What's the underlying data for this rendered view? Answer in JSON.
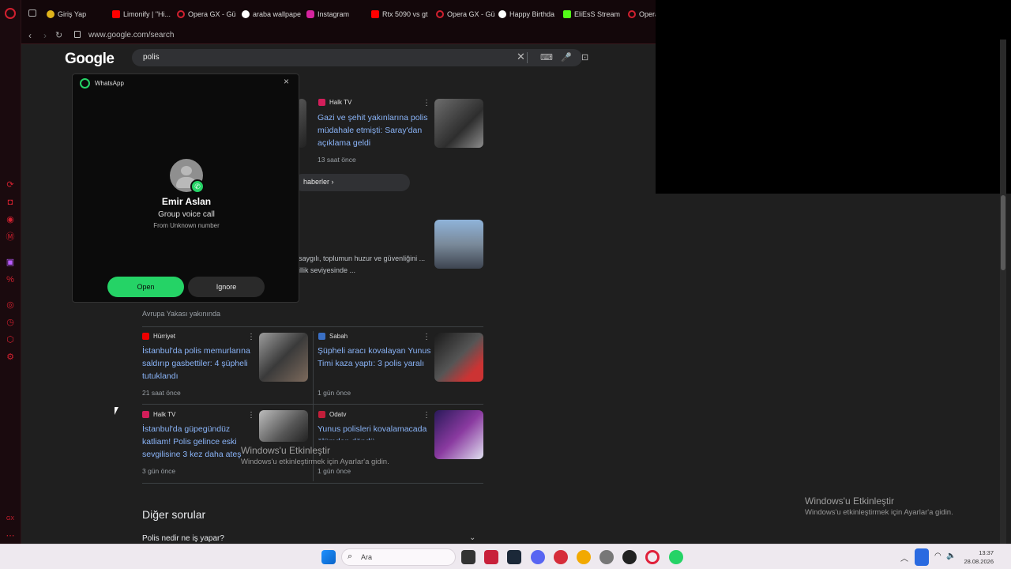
{
  "tabs": [
    "Giriş Yap",
    "Limonify | \"Hi...",
    "Opera GX - Gü",
    "araba wallpape",
    "Instagram",
    "Rtx 5090 vs gt",
    "Opera GX - Gü",
    "Happy Birthda",
    "EliEsS Stream",
    "Opera"
  ],
  "address": {
    "url": "www.google.com/search"
  },
  "page": {
    "logo": "Google",
    "query": "polis",
    "more_news": "haberler",
    "snippet": "saygılı, toplumun huzur ve güvenliğini ... illik seviyesinde ...",
    "local_label": "Avrupa Yakası yakınında",
    "other_questions": "Diğer sorular",
    "faq": [
      "Polis nedir ne iş yapar?"
    ]
  },
  "news": [
    {
      "source": "Halk TV",
      "title": "Gazi ve şehit yakınlarına polis müdahale etmişti: Saray'dan açıklama geldi",
      "time": "13 saat önce"
    }
  ],
  "local": [
    {
      "source": "Hürriyet",
      "title": "İstanbul'da polis memurlarına saldırıp gasbettiler: 4 şüpheli tutuklandı",
      "time": "21 saat önce"
    },
    {
      "source": "Sabah",
      "title": "Şüpheli aracı kovalayan Yunus Timi kaza yaptı: 3 polis yaralı",
      "time": "1 gün önce"
    },
    {
      "source": "Halk TV",
      "title": "İstanbul'da güpegündüz katliam! Polis gelince eski sevgilisine 3 kez daha ateş",
      "time": "3 gün önce"
    },
    {
      "source": "Odatv",
      "title": "Yunus polisleri kovalamacada ölümden döndü",
      "time": "1 gün önce"
    }
  ],
  "whatsapp": {
    "app_name": "WhatsApp",
    "caller": "Emir Aslan",
    "call_type": "Group voice call",
    "origin": "From Unknown number",
    "open_label": "Open",
    "ignore_label": "Ignore"
  },
  "watermark": {
    "title": "Windows'u Etkinleştir",
    "subtitle": "Windows'u etkinleştirmek için Ayarlar'a gidin."
  },
  "taskbar": {
    "search_placeholder": "Ara",
    "time": "13:37",
    "date": "28.08.2026"
  }
}
